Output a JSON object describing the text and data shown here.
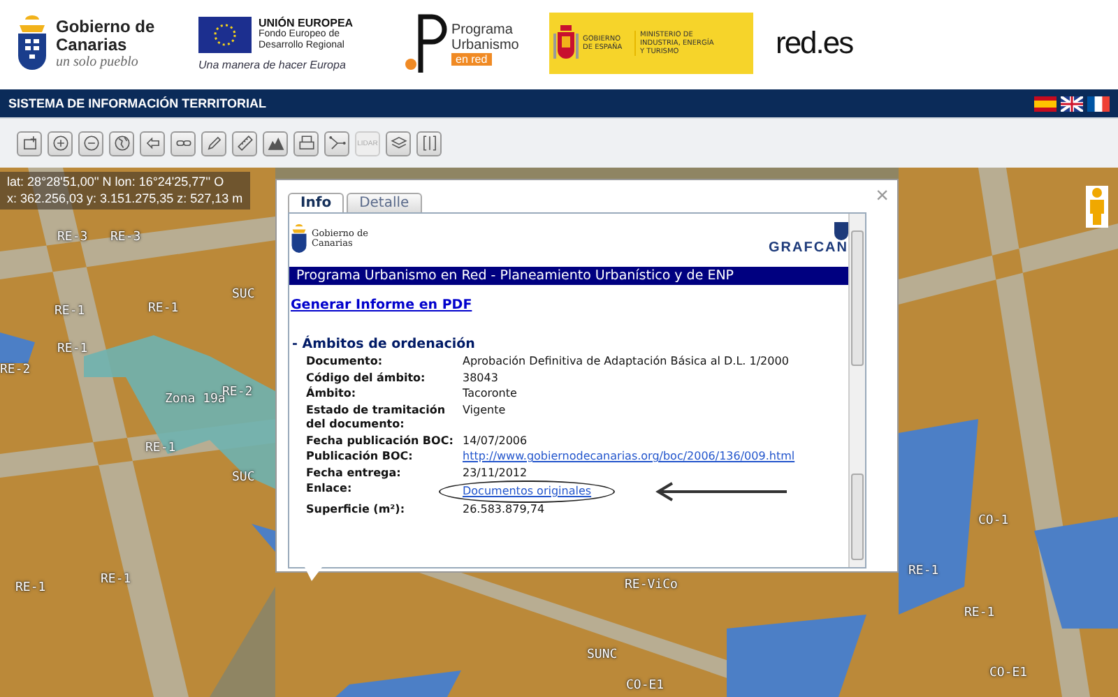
{
  "header": {
    "gobierno_canarias": {
      "name": "Gobierno de Canarias",
      "tagline": "un solo pueblo"
    },
    "union_europea": {
      "title": "UNIÓN EUROPEA",
      "subtitle": "Fondo Europeo de Desarrollo Regional",
      "motto": "Una manera de hacer Europa"
    },
    "programa": {
      "title": "Programa Urbanismo",
      "badge": "en red"
    },
    "gobierno_espana": {
      "name": "GOBIERNO DE ESPAÑA",
      "ministry": "MINISTERIO DE INDUSTRIA, ENERGÍA Y TURISMO"
    },
    "red_es": {
      "text": "red.es"
    }
  },
  "nav_bar": {
    "title": "SISTEMA DE INFORMACIÓN TERRITORIAL",
    "languages": [
      {
        "kind": "es"
      },
      {
        "kind": "uk"
      },
      {
        "kind": "fr"
      }
    ]
  },
  "toolbar": [
    {
      "kind": "extent",
      "disabled": false
    },
    {
      "kind": "zoomin",
      "disabled": false
    },
    {
      "kind": "zoomout",
      "disabled": false
    },
    {
      "kind": "globe",
      "disabled": false
    },
    {
      "kind": "back",
      "disabled": false
    },
    {
      "kind": "link",
      "disabled": false
    },
    {
      "kind": "pencil",
      "disabled": false
    },
    {
      "kind": "ruler",
      "disabled": false
    },
    {
      "kind": "profile",
      "disabled": false
    },
    {
      "kind": "print",
      "disabled": false
    },
    {
      "kind": "polyline",
      "disabled": false
    },
    {
      "kind": "text",
      "label": "LIDAR",
      "disabled": true
    },
    {
      "kind": "layers",
      "disabled": false
    },
    {
      "kind": "split",
      "disabled": false
    }
  ],
  "map": {
    "coordinates": [
      "lat: 28°28'51,00'' N  lon: 16°24'25,77'' O",
      "x: 362.256,03  y: 3.151.275,35  z: 527,13 m"
    ],
    "labels": [
      "RE-3",
      "RE-3",
      "RE-1",
      "RE-1",
      "SUC",
      "RE-1",
      "RE-2",
      "Zona 19a",
      "RE-2",
      "RE-1",
      "SUC",
      "RE-1",
      "RE-1",
      "RE-ViCo",
      "SUNC",
      "CO-E1",
      "CO-E1",
      "CO-1",
      "RE-1",
      "RE-1"
    ]
  },
  "popup": {
    "tabs": [
      {
        "label": "Info",
        "selected": true
      },
      {
        "label": "Detalle",
        "selected": false
      }
    ],
    "close": "×",
    "logo_left": "Gobierno de Canarias",
    "logo_right": "GRAFCAN",
    "banner": "Programa Urbanismo en Red - Planeamiento Urbanístico y de ENP",
    "pdf_link": "Generar Informe en PDF",
    "section": "- Ámbitos de ordenación",
    "fields": [
      {
        "label": "Documento:",
        "value": "Aprobación Definitiva de Adaptación Básica al D.L. 1/2000",
        "kind": "text"
      },
      {
        "label": "Código del ámbito:",
        "value": "38043",
        "kind": "text"
      },
      {
        "label": "Ámbito:",
        "value": "Tacoronte",
        "kind": "text"
      },
      {
        "label": "Estado de tramitación del documento:",
        "value": "Vigente",
        "kind": "text"
      },
      {
        "label": "Fecha publicación BOC:",
        "value": "14/07/2006",
        "kind": "text"
      },
      {
        "label": "Publicación BOC:",
        "value": "http://www.gobiernodecanarias.org/boc/2006/136/009.html",
        "kind": "link"
      },
      {
        "label": "Fecha entrega:",
        "value": "23/11/2012",
        "kind": "text"
      },
      {
        "label": "Enlace:",
        "value": "Documentos originales",
        "kind": "link",
        "circled": true
      },
      {
        "label": "Superficie (m²):",
        "value": "26.583.879,74",
        "kind": "text"
      }
    ]
  }
}
